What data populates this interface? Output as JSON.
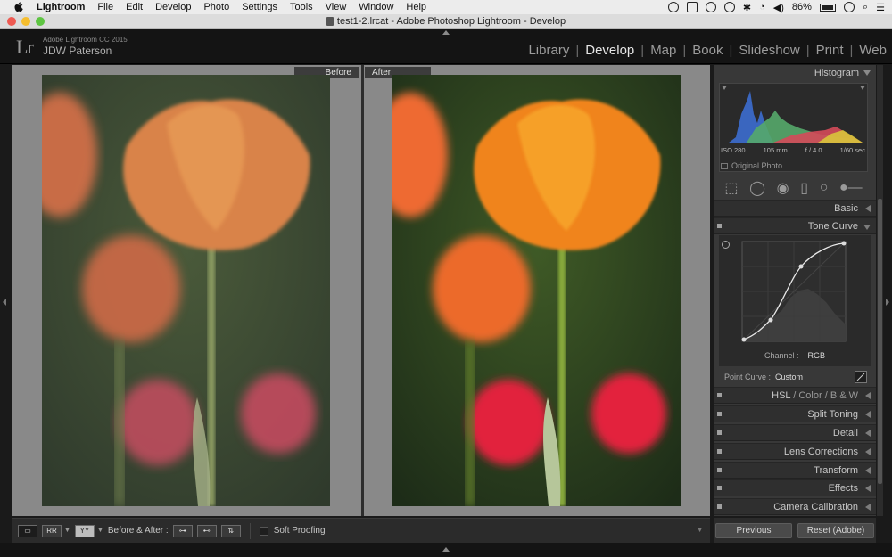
{
  "menubar": {
    "app": "Lightroom",
    "items": [
      "File",
      "Edit",
      "Develop",
      "Photo",
      "Settings",
      "Tools",
      "View",
      "Window",
      "Help"
    ],
    "battery": "86%"
  },
  "window": {
    "title": "test1-2.lrcat - Adobe Photoshop Lightroom - Develop"
  },
  "identity": {
    "logo": "Lr",
    "version": "Adobe Lightroom CC 2015",
    "user": "JDW Paterson"
  },
  "modules": [
    "Library",
    "Develop",
    "Map",
    "Book",
    "Slideshow",
    "Print",
    "Web"
  ],
  "active_module": "Develop",
  "panes": {
    "before": "Before",
    "after": "After"
  },
  "histogram": {
    "title": "Histogram",
    "iso": "ISO 280",
    "focal": "105 mm",
    "aperture": "f / 4.0",
    "shutter": "1/60 sec",
    "original_photo": "Original Photo"
  },
  "panels": {
    "basic": "Basic",
    "tone_curve": "Tone Curve",
    "hsl": "HSL",
    "color": "Color",
    "bw": "B & W",
    "split_toning": "Split Toning",
    "detail": "Detail",
    "lens_corrections": "Lens Corrections",
    "transform": "Transform",
    "effects": "Effects",
    "camera_calibration": "Camera Calibration"
  },
  "tone_curve": {
    "channel_label": "Channel :",
    "channel_value": "RGB",
    "point_curve_label": "Point Curve :",
    "point_curve_value": "Custom"
  },
  "toolbar": {
    "before_after_label": "Before & After :",
    "soft_proofing": "Soft Proofing"
  },
  "buttons": {
    "previous": "Previous",
    "reset": "Reset (Adobe)"
  }
}
